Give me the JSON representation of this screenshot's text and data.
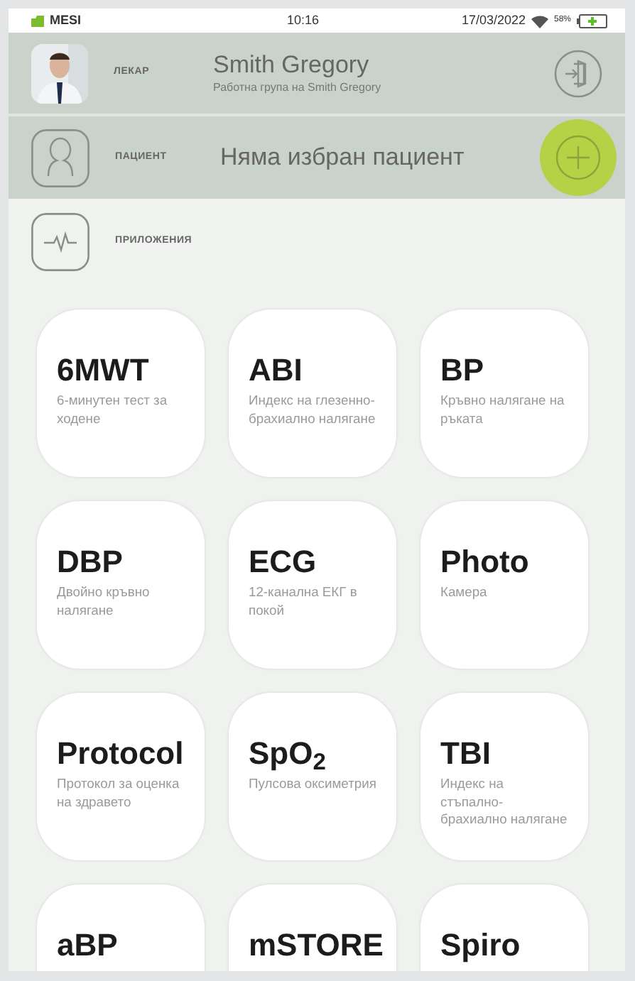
{
  "status_bar": {
    "brand": "MESI",
    "time": "10:16",
    "date": "17/03/2022",
    "battery": "58%"
  },
  "doctor": {
    "label": "ЛЕКАР",
    "name": "Smith Gregory",
    "group": "Работна група на Smith Gregory"
  },
  "patient": {
    "label": "ПАЦИЕНТ",
    "name": "Няма избран пациент"
  },
  "applications": {
    "label": "ПРИЛОЖЕНИЯ"
  },
  "apps": [
    {
      "title": "6MWT",
      "description": "6-минутен тест за ходене"
    },
    {
      "title": "ABI",
      "description": "Индекс на глезенно-брахиално налягане"
    },
    {
      "title": "BP",
      "description": "Кръвно налягане на ръката"
    },
    {
      "title": "DBP",
      "description": "Двойно кръвно налягане"
    },
    {
      "title": "ECG",
      "description": "12-канална ЕКГ в покой"
    },
    {
      "title": "Photo",
      "description": "Камера"
    },
    {
      "title": "Protocol",
      "description": "Протокол за оценка на здравето"
    },
    {
      "title": "SpO$_{2}$",
      "description": "Пулсова оксиметрия"
    },
    {
      "title": "TBI",
      "description": "Индекс на стъпално-брахиално налягане"
    },
    {
      "title": "aBP"
    },
    {
      "title": "mSTORE"
    },
    {
      "title": "Spiro"
    }
  ]
}
